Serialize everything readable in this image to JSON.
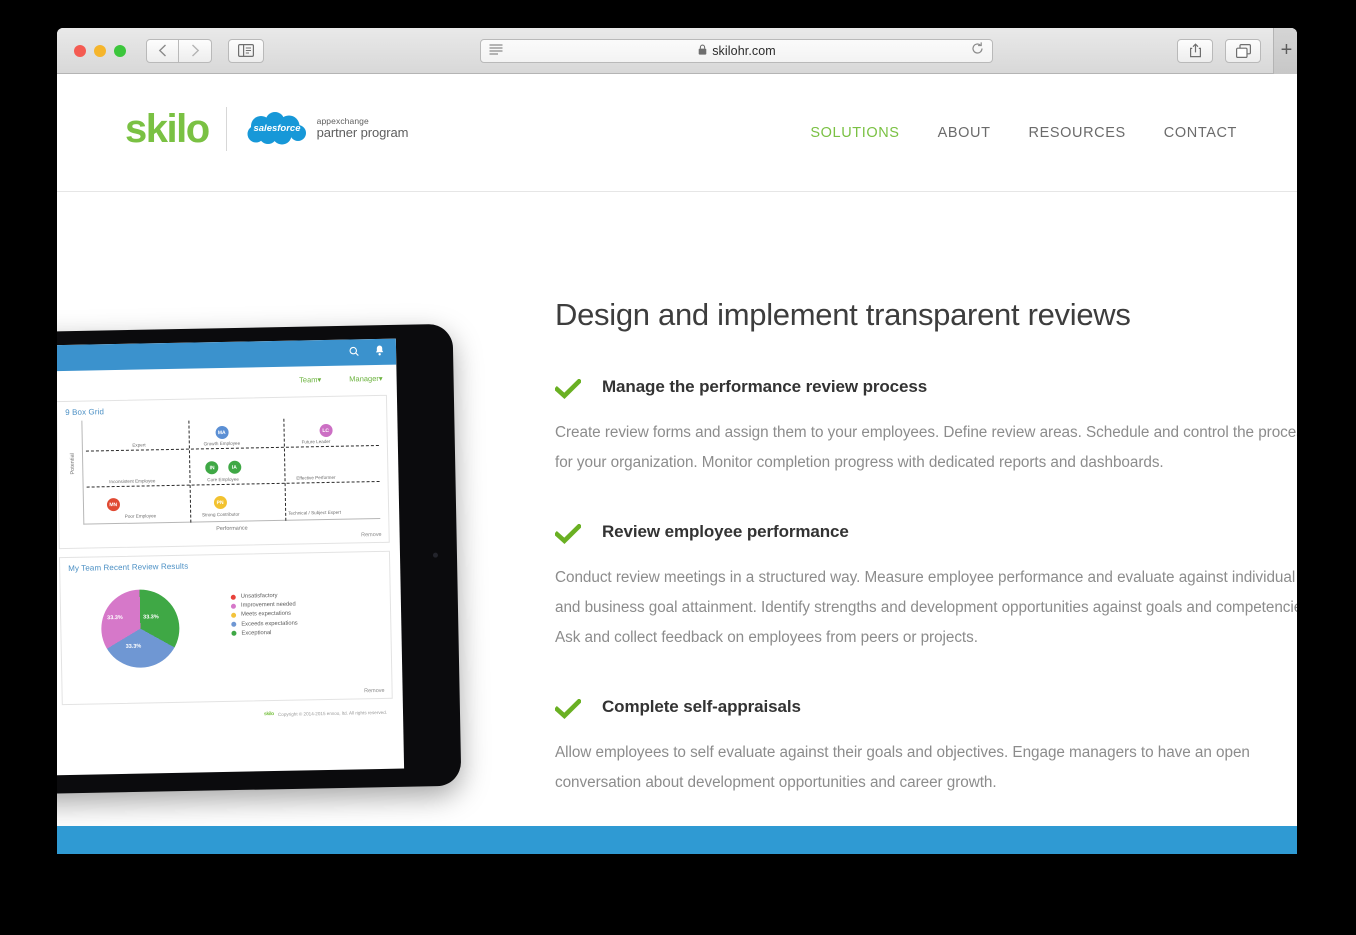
{
  "browser": {
    "url": "skilohr.com",
    "lock_icon": "lock-icon",
    "reader_icon": "reader-view-icon",
    "reload_icon": "reload-icon",
    "back_icon": "back-chevron-icon",
    "forward_icon": "forward-chevron-icon",
    "sidebar_icon": "sidebar-toggle-icon",
    "share_icon": "share-icon",
    "tabs_icon": "show-tabs-icon",
    "new_tab_label": "+"
  },
  "header": {
    "logo_text": "skilo",
    "partner_line1": "appexchange",
    "partner_line2": "partner program",
    "salesforce_wordmark": "salesforce",
    "nav": [
      {
        "label": "SOLUTIONS",
        "active": true
      },
      {
        "label": "ABOUT",
        "active": false
      },
      {
        "label": "RESOURCES",
        "active": false
      },
      {
        "label": "CONTACT",
        "active": false
      }
    ]
  },
  "main": {
    "title": "Design and implement transparent reviews",
    "features": [
      {
        "title": "Manage the performance review process",
        "body": "Create review forms and assign them to your employees. Define review areas. Schedule and control the process for your organization. Monitor completion progress with dedicated reports and dashboards."
      },
      {
        "title": "Review employee performance",
        "body": "Conduct review meetings in a structured way. Measure employee performance and evaluate against individual and business goal attainment. Identify strengths and development opportunities against goals and competencies. Ask and collect feedback on employees from peers or projects."
      },
      {
        "title": "Complete self-appraisals",
        "body": "Allow employees to self evaluate against their goals and objectives. Engage managers to have an open conversation about development opportunities and career growth."
      }
    ]
  },
  "tablet_app": {
    "search_icon": "search-icon",
    "bell_icon": "notification-bell-icon",
    "menus": [
      {
        "label": "Team"
      },
      {
        "label": "Manager"
      }
    ],
    "remove_label": "Remove",
    "footer_brand": "skilo",
    "footer_copyright": "Copyright © 2014-2015 enxoo, ltd. All rights reserved."
  },
  "chart_data": [
    {
      "type": "scatter",
      "title": "9 Box Grid",
      "xlabel": "Performance",
      "ylabel": "Potential",
      "grid": true,
      "cells": [
        "Expert",
        "Growth Employee",
        "Future Leader",
        "Inconsistent Employee",
        "Core Employee",
        "Effective Performer",
        "Poor Employee",
        "Strong Contributor",
        "Technical / Subject Expert"
      ],
      "points": [
        {
          "label": "MA",
          "x": 52,
          "y": 85,
          "color": "#5b8fd4"
        },
        {
          "label": "LC",
          "x": 86,
          "y": 85,
          "color": "#cc6fc4"
        },
        {
          "label": "IN",
          "x": 47,
          "y": 50,
          "color": "#3fa845"
        },
        {
          "label": "IA",
          "x": 55,
          "y": 50,
          "color": "#3fa845"
        },
        {
          "label": "MN",
          "x": 13,
          "y": 16,
          "color": "#e04a33"
        },
        {
          "label": "PN",
          "x": 50,
          "y": 16,
          "color": "#f2c230"
        }
      ]
    },
    {
      "type": "pie",
      "title": "My Team Recent Review Results",
      "legend_position": "right",
      "categories": [
        "Unsatisfactory",
        "Improvement needed",
        "Meets expectations",
        "Exceeds expectations",
        "Exceptional"
      ],
      "colors": [
        "#e8413a",
        "#d678c9",
        "#f3c33c",
        "#6f97d3",
        "#3fa845"
      ],
      "slices": [
        {
          "name": "Exceptional",
          "value": 33.3,
          "data_label": "33.3%",
          "color": "#3fa845"
        },
        {
          "name": "Exceeds expectations",
          "value": 33.3,
          "data_label": "33.3%",
          "color": "#6f97d3"
        },
        {
          "name": "Improvement needed",
          "value": 33.3,
          "data_label": "33.3%",
          "color": "#d678c9"
        }
      ]
    }
  ],
  "colors": {
    "brand_green": "#7ac143",
    "accent_blue": "#2f9ad3",
    "app_blue": "#3b92cd",
    "body_gray": "#8c8c8c"
  }
}
